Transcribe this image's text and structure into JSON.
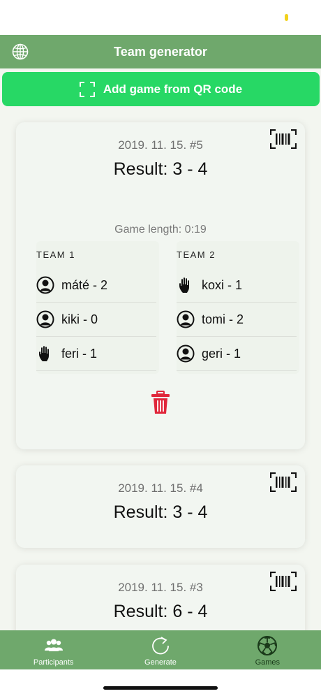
{
  "nav": {
    "title": "Team generator",
    "globe_icon": "globe-icon"
  },
  "qr_button": {
    "label": "Add game from QR code",
    "icon": "qr-scan-icon"
  },
  "colors": {
    "header": "#6fa86c",
    "qr_button": "#27d865",
    "delete": "#e0263a",
    "card": "#f2f6f1"
  },
  "games": [
    {
      "date": "2019. 11. 15. #5",
      "result": "Result: 3 - 4",
      "length": "Game length: 0:19",
      "teams": [
        {
          "name": "TEAM 1",
          "players": [
            {
              "name": "máté - 2",
              "icon": "person-icon"
            },
            {
              "name": "kiki - 0",
              "icon": "person-icon"
            },
            {
              "name": "feri - 1",
              "icon": "hand-icon"
            }
          ]
        },
        {
          "name": "TEAM 2",
          "players": [
            {
              "name": "koxi - 1",
              "icon": "hand-icon"
            },
            {
              "name": "tomi - 2",
              "icon": "person-icon"
            },
            {
              "name": "geri - 1",
              "icon": "person-icon"
            }
          ]
        }
      ]
    },
    {
      "date": "2019. 11. 15. #4",
      "result": "Result: 3 - 4"
    },
    {
      "date": "2019. 11. 15. #3",
      "result": "Result: 6 - 4"
    }
  ],
  "tabs": [
    {
      "label": "Participants",
      "icon": "participants-icon",
      "active": false
    },
    {
      "label": "Generate",
      "icon": "refresh-icon",
      "active": false
    },
    {
      "label": "Games",
      "icon": "soccer-ball-icon",
      "active": true
    }
  ]
}
